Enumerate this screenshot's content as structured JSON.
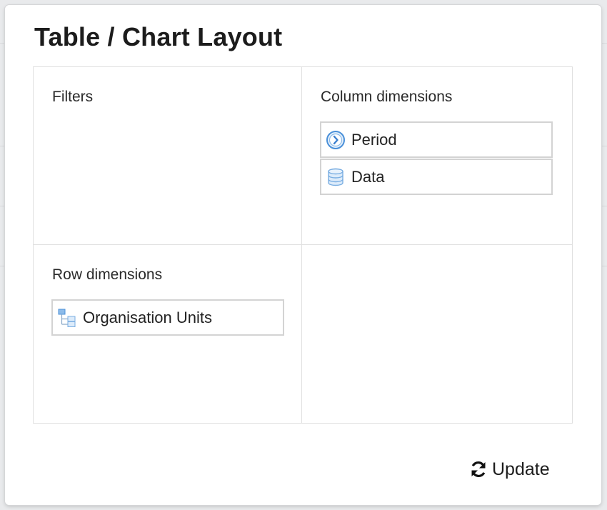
{
  "dialog": {
    "title": "Table / Chart Layout"
  },
  "layout": {
    "filters": {
      "label": "Filters",
      "items": []
    },
    "columns": {
      "label": "Column dimensions",
      "items": [
        {
          "label": "Period",
          "icon": "period-clock-icon"
        },
        {
          "label": "Data",
          "icon": "database-icon"
        }
      ]
    },
    "rows": {
      "label": "Row dimensions",
      "items": [
        {
          "label": "Organisation Units",
          "icon": "org-unit-tree-icon"
        }
      ]
    }
  },
  "actions": {
    "update_label": "Update",
    "update_icon": "refresh-icon"
  },
  "colors": {
    "icon_blue": "#4a90d9",
    "icon_fill": "#cfe3f7",
    "border": "#d3d3d3"
  }
}
